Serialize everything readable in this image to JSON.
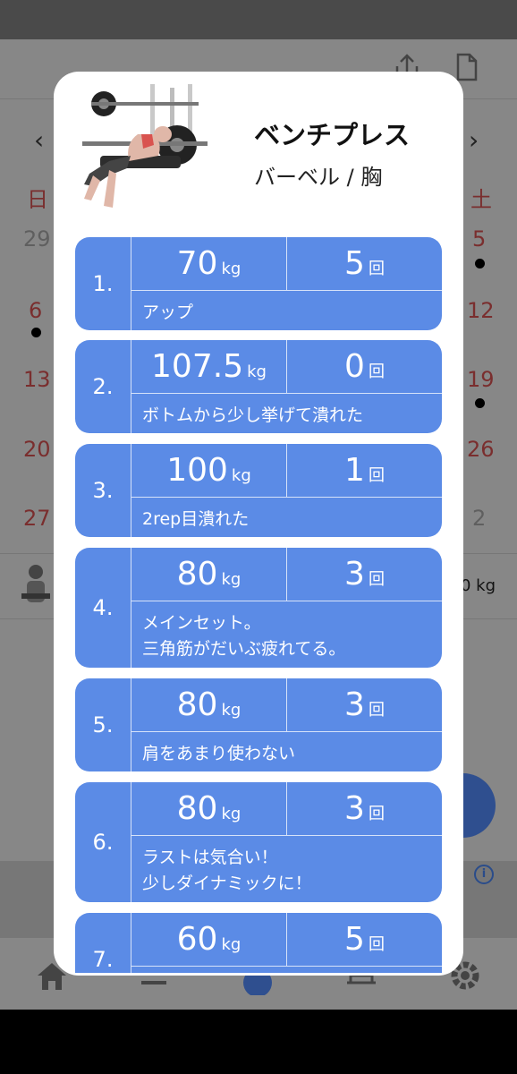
{
  "toolbar": {
    "icons": [
      "share-icon",
      "document-icon"
    ]
  },
  "calendar": {
    "prev_label": "‹",
    "next_label": "›",
    "dow_sun": "日",
    "dow_sat": "土",
    "left_days": [
      "29",
      "6",
      "13",
      "20",
      "27"
    ],
    "right_days": [
      "5",
      "12",
      "19",
      "26",
      "2"
    ]
  },
  "log_row": {
    "weight_text": "0 kg"
  },
  "modal": {
    "exercise_name": "ベンチプレス",
    "category": "バーベル / 胸",
    "sets": [
      {
        "no": "1.",
        "weight": "70",
        "unit": "kg",
        "reps": "5",
        "reps_unit": "回",
        "memo": "アップ"
      },
      {
        "no": "2.",
        "weight": "107.5",
        "unit": "kg",
        "reps": "0",
        "reps_unit": "回",
        "memo": "ボトムから少し挙げて潰れた"
      },
      {
        "no": "3.",
        "weight": "100",
        "unit": "kg",
        "reps": "1",
        "reps_unit": "回",
        "memo": "2rep目潰れた"
      },
      {
        "no": "4.",
        "weight": "80",
        "unit": "kg",
        "reps": "3",
        "reps_unit": "回",
        "memo": "メインセット。\n三角筋がだいぶ疲れてる。"
      },
      {
        "no": "5.",
        "weight": "80",
        "unit": "kg",
        "reps": "3",
        "reps_unit": "回",
        "memo": "肩をあまり使わない"
      },
      {
        "no": "6.",
        "weight": "80",
        "unit": "kg",
        "reps": "3",
        "reps_unit": "回",
        "memo": "ラストは気合い！\n少しダイナミックに！"
      },
      {
        "no": "7.",
        "weight": "60",
        "unit": "kg",
        "reps": "5",
        "reps_unit": "回",
        "memo": ""
      }
    ]
  },
  "colors": {
    "card": "#5b8be6",
    "overlay": "#878787",
    "accent_red": "#7a2e2e"
  }
}
